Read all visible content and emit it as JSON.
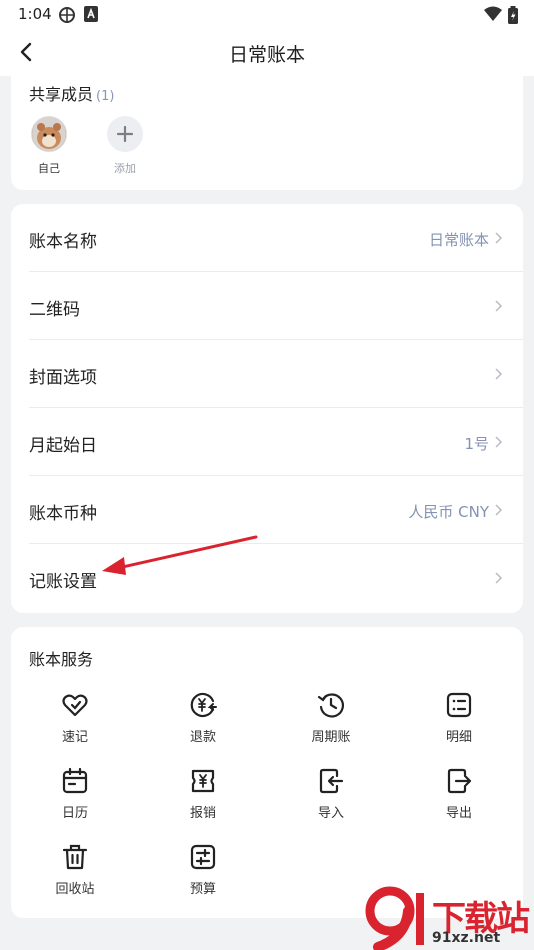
{
  "status_bar": {
    "time": "1:04"
  },
  "header": {
    "title": "日常账本"
  },
  "members": {
    "title": "共享成员",
    "count": "(1)",
    "items": [
      {
        "label": "自己"
      },
      {
        "label": "添加"
      }
    ]
  },
  "settings": {
    "rows": [
      {
        "label": "账本名称",
        "value": "日常账本"
      },
      {
        "label": "二维码",
        "value": ""
      },
      {
        "label": "封面选项",
        "value": ""
      },
      {
        "label": "月起始日",
        "value": "1号"
      },
      {
        "label": "账本币种",
        "value": "人民币 CNY"
      },
      {
        "label": "记账设置",
        "value": ""
      }
    ]
  },
  "services": {
    "title": "账本服务",
    "items": [
      {
        "label": "速记",
        "icon": "quick-note-icon"
      },
      {
        "label": "退款",
        "icon": "refund-icon"
      },
      {
        "label": "周期账",
        "icon": "recurring-icon"
      },
      {
        "label": "明细",
        "icon": "detail-icon"
      },
      {
        "label": "日历",
        "icon": "calendar-icon"
      },
      {
        "label": "报销",
        "icon": "reimburse-icon"
      },
      {
        "label": "导入",
        "icon": "import-icon"
      },
      {
        "label": "导出",
        "icon": "export-icon"
      },
      {
        "label": "回收站",
        "icon": "trash-icon"
      },
      {
        "label": "预算",
        "icon": "budget-icon"
      }
    ]
  },
  "watermark": {
    "brand": "下载站",
    "url": "91xz.net"
  },
  "colors": {
    "accent_value": "#8592b3",
    "annotation_arrow": "#d9232e"
  }
}
